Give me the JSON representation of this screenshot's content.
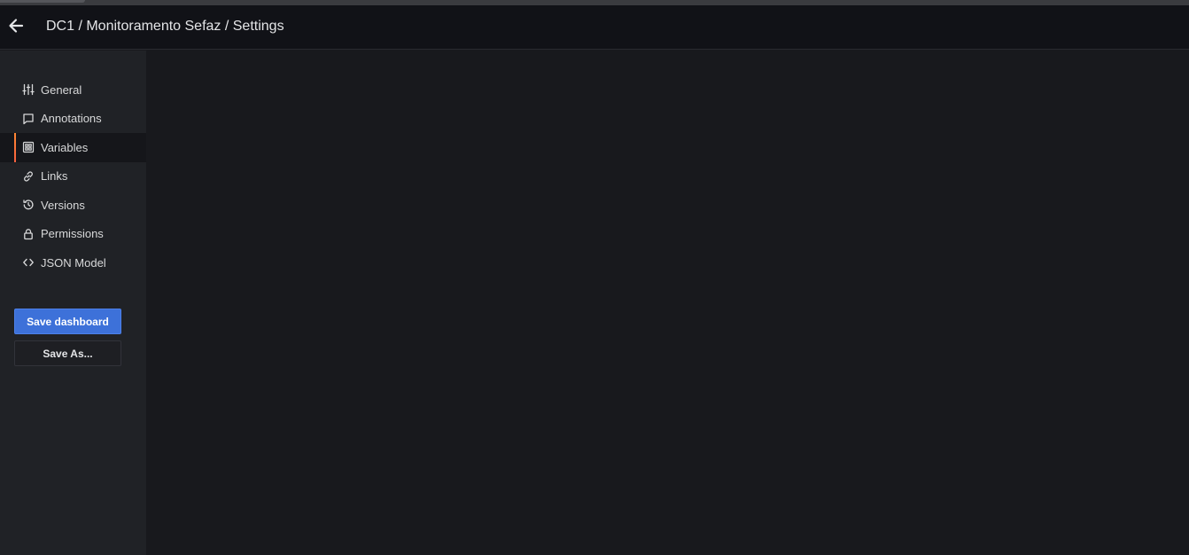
{
  "header": {
    "title": "DC1 / Monitoramento Sefaz / Settings",
    "back_icon": "arrow-left-icon"
  },
  "sidebar": {
    "items": [
      {
        "label": "General",
        "icon": "sliders-icon"
      },
      {
        "label": "Annotations",
        "icon": "comment-icon"
      },
      {
        "label": "Variables",
        "icon": "variable-grid-icon",
        "active": true
      },
      {
        "label": "Links",
        "icon": "link-icon"
      },
      {
        "label": "Versions",
        "icon": "history-icon"
      },
      {
        "label": "Permissions",
        "icon": "lock-icon"
      },
      {
        "label": "JSON Model",
        "icon": "code-icon"
      }
    ],
    "save_label": "Save dashboard",
    "save_as_label": "Save As..."
  },
  "colors": {
    "background": "#18191d",
    "header": "#111217",
    "sidebar": "#202226",
    "primary_button": "#3d71d9",
    "active_accent": "#ff8833"
  }
}
